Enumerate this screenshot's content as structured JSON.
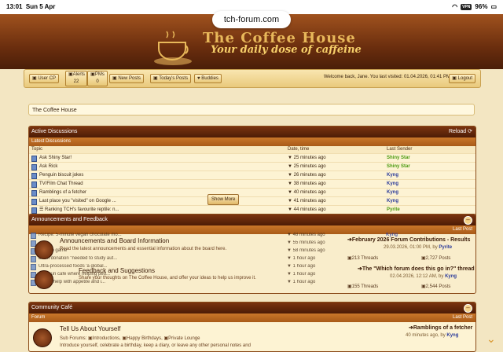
{
  "status": {
    "time": "13:01",
    "date": "Sun 5 Apr",
    "vpn": "VPN",
    "battery": "96%"
  },
  "url": "tch-forum.com",
  "banner": {
    "title": "The Coffee House",
    "subtitle": "Your daily dose of caffeine"
  },
  "nav": {
    "user_cp": "User CP",
    "alerts_label": "Alerts",
    "alerts_count": "22",
    "pms_label": "PMs",
    "pms_count": "0",
    "new_posts": "New Posts",
    "todays_posts": "Today's Posts",
    "buddies": "Buddies",
    "welcome": "Welcome back, Jane. You last visited: 01.04.2026, 01:41 PM",
    "logout": "Logout"
  },
  "breadcrumb": "The Coffee House",
  "active": {
    "title": "Active Discussions",
    "reload": "Reload",
    "subtitle": "Latest Discussions",
    "col_topic": "Topic",
    "col_date": "Date, time",
    "col_sender": "Last Sender",
    "show_more": "Show More",
    "rows": [
      {
        "topic": "Ask Shiny Star!",
        "date": "▼ 25 minutes ago",
        "sender": "Shiny Star",
        "color": "#4a9a10"
      },
      {
        "topic": "Ask Rick",
        "date": "▼ 25 minutes ago",
        "sender": "Shiny Star",
        "color": "#4a9a10"
      },
      {
        "topic": "Penguin biscuit jokes",
        "date": "▼ 26 minutes ago",
        "sender": "Kyng",
        "color": "#2a3a9a"
      },
      {
        "topic": "TV/Film Chat Thread",
        "date": "▼ 38 minutes ago",
        "sender": "Kyng",
        "color": "#2a3a9a"
      },
      {
        "topic": "Ramblings of a fetcher",
        "date": "▼ 40 minutes ago",
        "sender": "Kyng",
        "color": "#2a3a9a"
      },
      {
        "topic": "Last place you \"visited\" on Google ...",
        "date": "▼ 41 minutes ago",
        "sender": "Kyng",
        "color": "#2a3a9a"
      },
      {
        "topic": "☰ Ranking TCH's favourite reptile: n...",
        "date": "▼ 44 minutes ago",
        "sender": "Pyrite",
        "color": "#4a9a10"
      },
      {
        "topic": "",
        "date": "▼ 44 minutes ago",
        "sender": "",
        "color": "#2a3a9a"
      },
      {
        "topic": "Recipe: 5-minute vegan chocolate mo...",
        "date": "▼ 48 minutes ago",
        "sender": "Kyng",
        "color": "#2a3a9a"
      },
      {
        "topic": "",
        "date": "▼ 55 minutes ago",
        "sender": "",
        "color": "#2a3a9a"
      },
      {
        "topic": "sign-up game",
        "date": "▼ 58 minutes ago",
        "sender": "",
        "color": "#2a3a9a"
      },
      {
        "topic": "Brain donation \"needed to study aut...",
        "date": "▼ 1 hour ago",
        "sender": "",
        "color": "#2a3a9a"
      },
      {
        "topic": "Ultra-processed foods 'a global...",
        "date": "▼ 1 hour ago",
        "sender": "",
        "color": "#2a3a9a"
      },
      {
        "topic": "Best run café where helping peo...",
        "date": "▼ 1 hour ago",
        "sender": "",
        "color": "#2a3a9a"
      },
      {
        "topic": "Seeds help with appetite and i...",
        "date": "▼ 1 hour ago",
        "sender": "",
        "color": "#2a3a9a"
      }
    ]
  },
  "announce": {
    "title": "Announcements and Feedback",
    "last_post_head": "Last Post",
    "f1_title": "Announcements and Board Information",
    "f1_desc": "Read the latest announcements and essential information about the board here.",
    "f1_lp_title": "February 2026 Forum Contributions - Results",
    "f1_lp_meta": "29.03.2026, 01:00 PM,  by",
    "f1_lp_user": "Pyrite",
    "f1_threads": "213 Threads",
    "f1_posts": "2,727 Posts",
    "f2_title": "Feedback and Suggestions",
    "f2_desc": "Share your thoughts on The Coffee House, and offer your ideas to help us improve it.",
    "f2_lp_title": "The \"Which forum does this go in?\" thread",
    "f2_lp_meta": "02.04.2026, 12:12 AM,  by",
    "f2_lp_user": "Kyng",
    "f2_threads": "155 Threads",
    "f2_posts": "2,544 Posts"
  },
  "cafe": {
    "title": "Community Café",
    "col_forum": "Forum",
    "col_last": "Last Post",
    "f1_title": "Tell Us About Yourself",
    "f1_sub_label": "Sub Forums:",
    "f1_sub1": "Introductions,",
    "f1_sub2": "Happy Birthdays,",
    "f1_sub3": "Private Lounge",
    "f1_desc": "Introduce yourself, celebrate a birthday, keep a diary, or leave any other personal notes and",
    "f1_lp_title": "Ramblings of a fetcher",
    "f1_lp_meta": "40 minutes ago,  by",
    "f1_lp_user": "Kyng"
  }
}
